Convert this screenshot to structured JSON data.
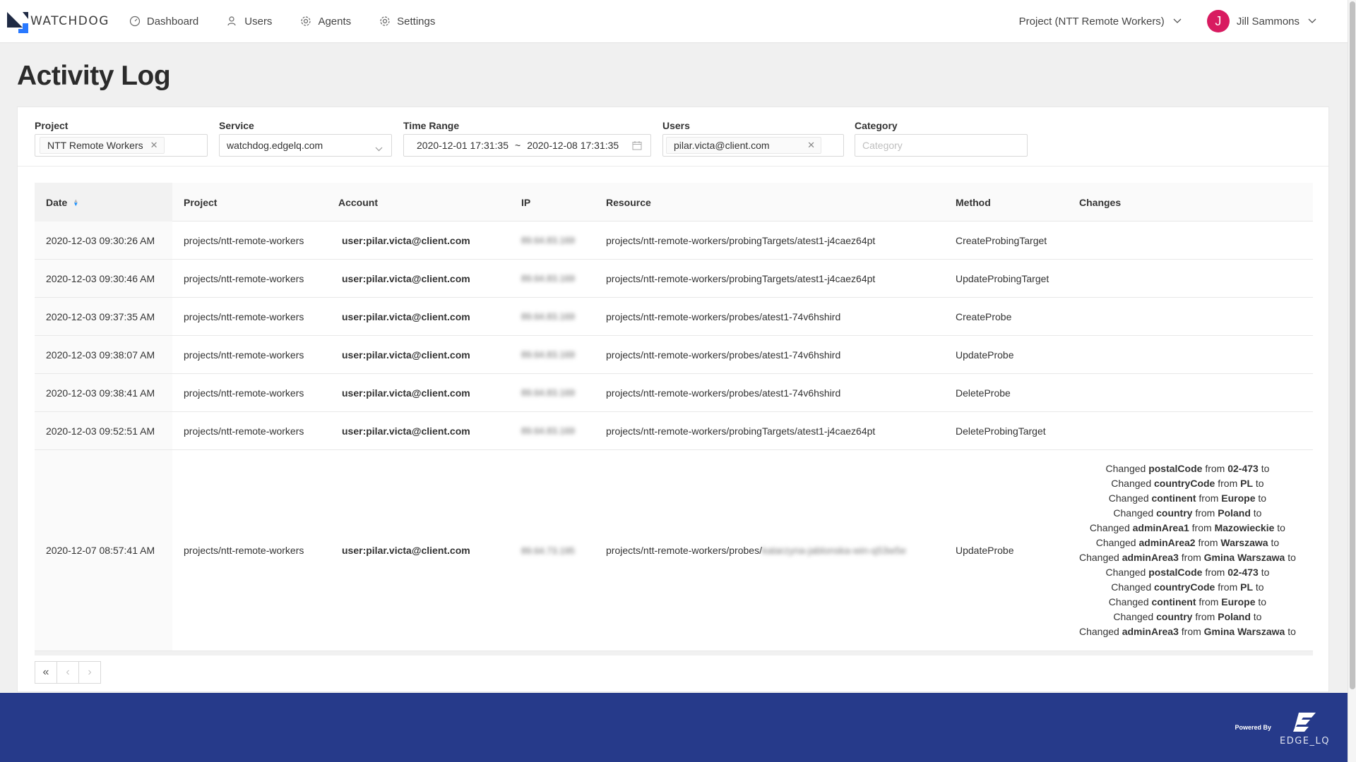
{
  "brand": {
    "name": "WATCHDOG"
  },
  "nav": {
    "items": [
      {
        "label": "Dashboard",
        "icon": "dashboard-icon"
      },
      {
        "label": "Users",
        "icon": "users-icon"
      },
      {
        "label": "Agents",
        "icon": "gear-icon"
      },
      {
        "label": "Settings",
        "icon": "gear-icon"
      }
    ],
    "project_selector": "Project (NTT Remote Workers)",
    "user": {
      "initial": "J",
      "name": "Jill Sammons"
    }
  },
  "page": {
    "title": "Activity Log"
  },
  "filters": {
    "project": {
      "label": "Project",
      "tag": "NTT Remote Workers"
    },
    "service": {
      "label": "Service",
      "value": "watchdog.edgelq.com"
    },
    "time_range": {
      "label": "Time Range",
      "start": "2020-12-01 17:31:35",
      "separator": "~",
      "end": "2020-12-08 17:31:35"
    },
    "users": {
      "label": "Users",
      "tag": "pilar.victa@client.com"
    },
    "category": {
      "label": "Category",
      "placeholder": "Category"
    }
  },
  "table": {
    "headers": [
      "Date",
      "Project",
      "Account",
      "IP",
      "Resource",
      "Method",
      "Changes"
    ],
    "rows": [
      {
        "date": "2020-12-03 09:30:26 AM",
        "project": "projects/ntt-remote-workers",
        "account": "user:pilar.victa@client.com",
        "ip": "89.64.83.169",
        "resource": "projects/ntt-remote-workers/probingTargets/atest1-j4caez64pt",
        "method": "CreateProbingTarget"
      },
      {
        "date": "2020-12-03 09:30:46 AM",
        "project": "projects/ntt-remote-workers",
        "account": "user:pilar.victa@client.com",
        "ip": "89.64.83.169",
        "resource": "projects/ntt-remote-workers/probingTargets/atest1-j4caez64pt",
        "method": "UpdateProbingTarget"
      },
      {
        "date": "2020-12-03 09:37:35 AM",
        "project": "projects/ntt-remote-workers",
        "account": "user:pilar.victa@client.com",
        "ip": "89.64.83.169",
        "resource": "projects/ntt-remote-workers/probes/atest1-74v6hshird",
        "method": "CreateProbe"
      },
      {
        "date": "2020-12-03 09:38:07 AM",
        "project": "projects/ntt-remote-workers",
        "account": "user:pilar.victa@client.com",
        "ip": "89.64.83.169",
        "resource": "projects/ntt-remote-workers/probes/atest1-74v6hshird",
        "method": "UpdateProbe"
      },
      {
        "date": "2020-12-03 09:38:41 AM",
        "project": "projects/ntt-remote-workers",
        "account": "user:pilar.victa@client.com",
        "ip": "89.64.83.169",
        "resource": "projects/ntt-remote-workers/probes/atest1-74v6hshird",
        "method": "DeleteProbe"
      },
      {
        "date": "2020-12-03 09:52:51 AM",
        "project": "projects/ntt-remote-workers",
        "account": "user:pilar.victa@client.com",
        "ip": "89.64.83.169",
        "resource": "projects/ntt-remote-workers/probingTargets/atest1-j4caez64pt",
        "method": "DeleteProbingTarget"
      },
      {
        "date": "2020-12-07 08:57:41 AM",
        "project": "projects/ntt-remote-workers",
        "account": "user:pilar.victa@client.com",
        "ip": "89.64.73.195",
        "resource_prefix": "projects/ntt-remote-workers/probes/",
        "resource_blurred": "katarzyna-jablonska-win-q53w5e",
        "method": "UpdateProbe",
        "changes": [
          {
            "prefix": "Changed",
            "field": "postalCode",
            "mid": "from",
            "value": "02-473",
            "suffix": "to"
          },
          {
            "prefix": "Changed",
            "field": "countryCode",
            "mid": "from",
            "value": "PL",
            "suffix": "to"
          },
          {
            "prefix": "Changed",
            "field": "continent",
            "mid": "from",
            "value": "Europe",
            "suffix": "to"
          },
          {
            "prefix": "Changed",
            "field": "country",
            "mid": "from",
            "value": "Poland",
            "suffix": "to"
          },
          {
            "prefix": "Changed",
            "field": "adminArea1",
            "mid": "from",
            "value": "Mazowieckie",
            "suffix": "to"
          },
          {
            "prefix": "Changed",
            "field": "adminArea2",
            "mid": "from",
            "value": "Warszawa",
            "suffix": "to"
          },
          {
            "prefix": "Changed",
            "field": "adminArea3",
            "mid": "from",
            "value": "Gmina Warszawa",
            "suffix": "to"
          },
          {
            "prefix": "Changed",
            "field": "postalCode",
            "mid": "from",
            "value": "02-473",
            "suffix": "to"
          },
          {
            "prefix": "Changed",
            "field": "countryCode",
            "mid": "from",
            "value": "PL",
            "suffix": "to"
          },
          {
            "prefix": "Changed",
            "field": "continent",
            "mid": "from",
            "value": "Europe",
            "suffix": "to"
          },
          {
            "prefix": "Changed",
            "field": "country",
            "mid": "from",
            "value": "Poland",
            "suffix": "to"
          },
          {
            "prefix": "Changed",
            "field": "adminArea3",
            "mid": "from",
            "value": "Gmina Warszawa",
            "suffix": "to"
          }
        ]
      }
    ]
  },
  "footer": {
    "powered_by": "Powered By",
    "vendor": "EDGE_LQ"
  },
  "colors": {
    "footer_bg": "#263a8a",
    "avatar_bg": "#d81b60",
    "sort_active": "#1890ff"
  }
}
